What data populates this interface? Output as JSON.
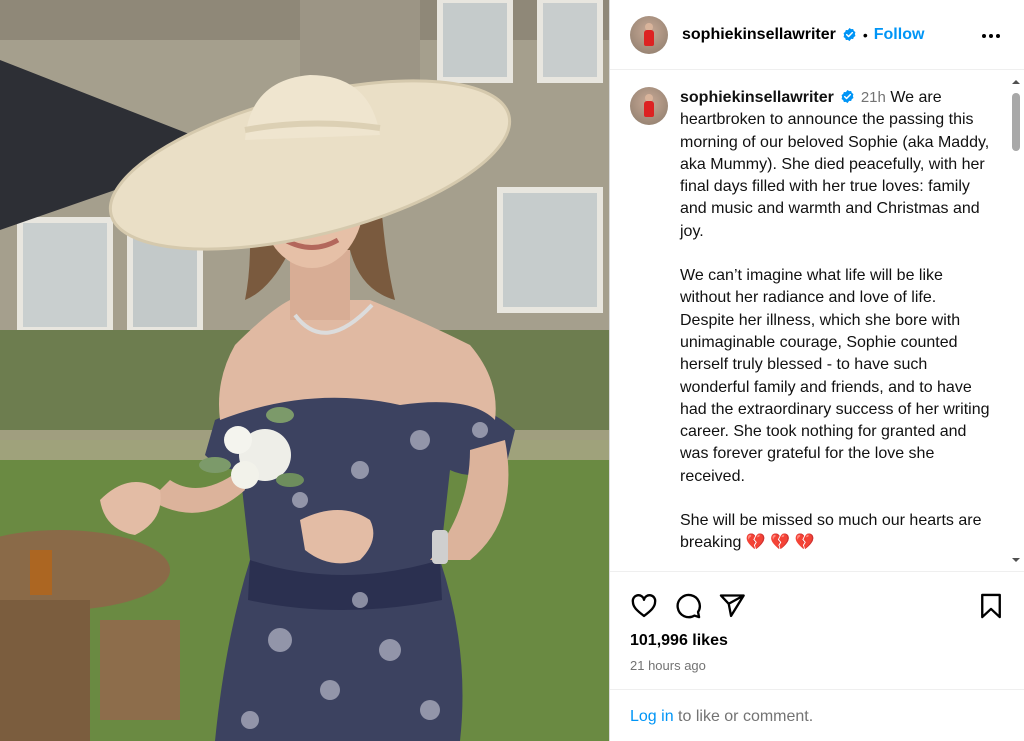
{
  "post": {
    "image_description_icon": "photo"
  },
  "header": {
    "username": "sophiekinsellawriter",
    "separator": "•",
    "follow_label": "Follow",
    "more_icon": "more-horizontal-icon"
  },
  "caption": {
    "username": "sophiekinsellawriter",
    "time": "21h",
    "paragraphs": [
      "We are heartbroken to announce the passing this morning of our beloved Sophie (aka Maddy, aka Mummy). She died peacefully, with her final days filled with her true loves: family and music and warmth and Christmas and joy.",
      "We can’t imagine what life will be like without her radiance and love of life. Despite her illness, which she bore with unimaginable courage, Sophie counted herself truly blessed - to have such wonderful family and friends, and to have had the extraordinary success of her writing career. She took nothing for granted and was forever grateful for the love she received."
    ],
    "last_line": "She will be missed so much our hearts are breaking",
    "hearts": "💔 💔 💔"
  },
  "actions": {
    "like_icon": "heart-icon",
    "comment_icon": "comment-icon",
    "share_icon": "share-icon",
    "save_icon": "bookmark-icon"
  },
  "stats": {
    "likes": "101,996 likes",
    "timestamp": "21 hours ago"
  },
  "login": {
    "link_text": "Log in",
    "rest_text": " to like or comment."
  },
  "colors": {
    "accent": "#0095f6",
    "verified": "#0095f6",
    "muted": "#737373"
  }
}
